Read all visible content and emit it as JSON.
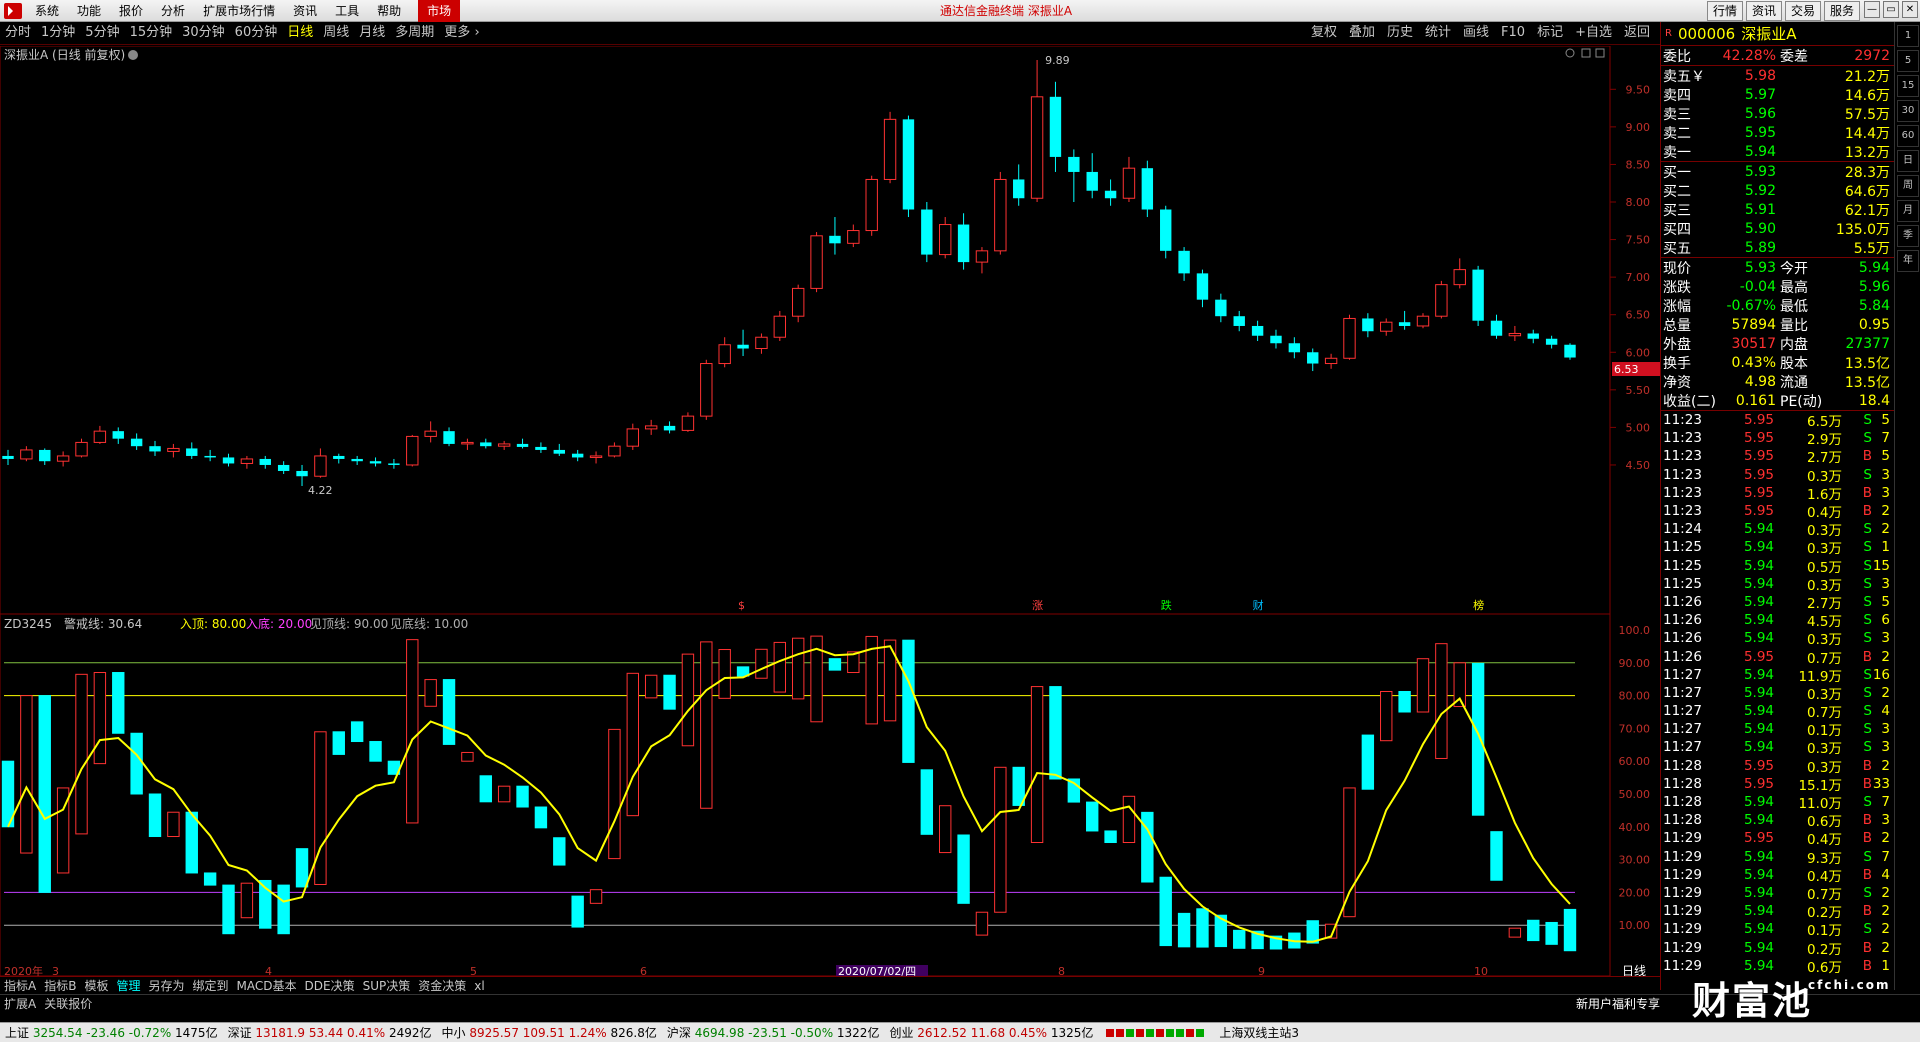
{
  "menubar": {
    "items": [
      "系统",
      "功能",
      "报价",
      "分析",
      "扩展市场行情",
      "资讯",
      "工具",
      "帮助"
    ],
    "market": "市场",
    "title": "通达信金融终端  深振业A",
    "right_buttons": [
      "行情",
      "资讯",
      "交易",
      "服务"
    ]
  },
  "periods": [
    "分时",
    "1分钟",
    "5分钟",
    "15分钟",
    "30分钟",
    "60分钟",
    "日线",
    "周线",
    "月线",
    "多周期",
    "更多"
  ],
  "active_period": "日线",
  "chart_tools": [
    "复权",
    "叠加",
    "历史",
    "统计",
    "画线",
    "F10",
    "标记",
    "+自选",
    "返回"
  ],
  "chart": {
    "title": "深振业A (日线 前复权)",
    "high_label": "9.89",
    "low_label": "4.22",
    "current_price_tag": "6.53",
    "y_ticks": [
      "9.50",
      "9.00",
      "8.50",
      "8.00",
      "7.50",
      "7.00",
      "6.50",
      "6.00",
      "5.50",
      "5.00",
      "4.50"
    ],
    "event_markers": [
      "$",
      "涨",
      "跌",
      "财",
      "榜"
    ],
    "date_axis": [
      "2020年",
      "3",
      "4",
      "5",
      "6",
      "2020/07/02/四",
      "8",
      "9",
      "10"
    ],
    "period_label": "日线"
  },
  "indicator": {
    "name": "ZD3245",
    "warn_label": "警戒线: 30.64",
    "params": [
      "入顶: 80.00",
      "入底: 20.00",
      "见顶线: 90.00",
      "见底线: 10.00"
    ],
    "y_ticks": [
      "100.0",
      "90.00",
      "80.00",
      "70.00",
      "60.00",
      "50.00",
      "40.00",
      "30.00",
      "20.00",
      "10.00"
    ]
  },
  "chart_data": {
    "type": "candlestick",
    "title": "深振业A (日线 前复权)",
    "ylim": [
      4.0,
      10.0
    ],
    "candles_ohlc": [
      [
        4.62,
        4.7,
        4.5,
        4.58
      ],
      [
        4.58,
        4.75,
        4.55,
        4.7
      ],
      [
        4.7,
        4.72,
        4.5,
        4.55
      ],
      [
        4.55,
        4.68,
        4.48,
        4.62
      ],
      [
        4.62,
        4.85,
        4.6,
        4.8
      ],
      [
        4.8,
        5.02,
        4.78,
        4.95
      ],
      [
        4.95,
        5.0,
        4.78,
        4.85
      ],
      [
        4.85,
        4.92,
        4.7,
        4.75
      ],
      [
        4.75,
        4.82,
        4.62,
        4.68
      ],
      [
        4.68,
        4.78,
        4.6,
        4.72
      ],
      [
        4.72,
        4.8,
        4.58,
        4.62
      ],
      [
        4.62,
        4.7,
        4.55,
        4.6
      ],
      [
        4.6,
        4.65,
        4.48,
        4.52
      ],
      [
        4.52,
        4.62,
        4.45,
        4.58
      ],
      [
        4.58,
        4.62,
        4.45,
        4.5
      ],
      [
        4.5,
        4.55,
        4.38,
        4.42
      ],
      [
        4.42,
        4.5,
        4.22,
        4.35
      ],
      [
        4.35,
        4.72,
        4.33,
        4.62
      ],
      [
        4.62,
        4.65,
        4.52,
        4.58
      ],
      [
        4.58,
        4.62,
        4.5,
        4.55
      ],
      [
        4.55,
        4.6,
        4.48,
        4.52
      ],
      [
        4.52,
        4.58,
        4.45,
        4.5
      ],
      [
        4.5,
        4.9,
        4.48,
        4.88
      ],
      [
        4.88,
        5.08,
        4.8,
        4.95
      ],
      [
        4.95,
        5.0,
        4.75,
        4.78
      ],
      [
        4.78,
        4.85,
        4.7,
        4.8
      ],
      [
        4.8,
        4.85,
        4.72,
        4.75
      ],
      [
        4.75,
        4.82,
        4.7,
        4.78
      ],
      [
        4.78,
        4.85,
        4.72,
        4.74
      ],
      [
        4.74,
        4.8,
        4.66,
        4.7
      ],
      [
        4.7,
        4.78,
        4.62,
        4.65
      ],
      [
        4.65,
        4.7,
        4.55,
        4.6
      ],
      [
        4.6,
        4.68,
        4.52,
        4.62
      ],
      [
        4.62,
        4.8,
        4.6,
        4.75
      ],
      [
        4.75,
        5.05,
        4.7,
        4.98
      ],
      [
        4.98,
        5.1,
        4.9,
        5.02
      ],
      [
        5.02,
        5.08,
        4.92,
        4.96
      ],
      [
        4.96,
        5.2,
        4.94,
        5.15
      ],
      [
        5.15,
        5.9,
        5.1,
        5.85
      ],
      [
        5.85,
        6.2,
        5.8,
        6.1
      ],
      [
        6.1,
        6.3,
        5.95,
        6.05
      ],
      [
        6.05,
        6.25,
        5.98,
        6.2
      ],
      [
        6.2,
        6.55,
        6.15,
        6.48
      ],
      [
        6.48,
        6.9,
        6.4,
        6.85
      ],
      [
        6.85,
        7.6,
        6.8,
        7.55
      ],
      [
        7.55,
        7.8,
        7.3,
        7.45
      ],
      [
        7.45,
        7.7,
        7.4,
        7.62
      ],
      [
        7.62,
        8.35,
        7.55,
        8.3
      ],
      [
        8.3,
        9.2,
        8.25,
        9.1
      ],
      [
        9.1,
        9.15,
        7.8,
        7.9
      ],
      [
        7.9,
        8.0,
        7.2,
        7.3
      ],
      [
        7.3,
        7.8,
        7.25,
        7.7
      ],
      [
        7.7,
        7.85,
        7.1,
        7.2
      ],
      [
        7.2,
        7.4,
        7.05,
        7.35
      ],
      [
        7.35,
        8.4,
        7.3,
        8.3
      ],
      [
        8.3,
        8.5,
        7.95,
        8.05
      ],
      [
        8.05,
        9.89,
        8.0,
        9.4
      ],
      [
        9.4,
        9.6,
        8.4,
        8.6
      ],
      [
        8.6,
        8.7,
        8.0,
        8.4
      ],
      [
        8.4,
        8.65,
        8.05,
        8.15
      ],
      [
        8.15,
        8.3,
        7.95,
        8.05
      ],
      [
        8.05,
        8.6,
        8.0,
        8.45
      ],
      [
        8.45,
        8.55,
        7.8,
        7.9
      ],
      [
        7.9,
        7.95,
        7.25,
        7.35
      ],
      [
        7.35,
        7.4,
        6.95,
        7.05
      ],
      [
        7.05,
        7.1,
        6.6,
        6.7
      ],
      [
        6.7,
        6.78,
        6.4,
        6.48
      ],
      [
        6.48,
        6.55,
        6.28,
        6.35
      ],
      [
        6.35,
        6.42,
        6.15,
        6.22
      ],
      [
        6.22,
        6.3,
        6.05,
        6.12
      ],
      [
        6.12,
        6.2,
        5.92,
        6.0
      ],
      [
        6.0,
        6.05,
        5.75,
        5.85
      ],
      [
        5.85,
        5.98,
        5.78,
        5.92
      ],
      [
        5.92,
        6.5,
        5.9,
        6.45
      ],
      [
        6.45,
        6.52,
        6.2,
        6.28
      ],
      [
        6.28,
        6.45,
        6.22,
        6.4
      ],
      [
        6.4,
        6.55,
        6.3,
        6.35
      ],
      [
        6.35,
        6.52,
        6.32,
        6.48
      ],
      [
        6.48,
        6.95,
        6.45,
        6.9
      ],
      [
        6.9,
        7.25,
        6.85,
        7.1
      ],
      [
        7.1,
        7.15,
        6.35,
        6.42
      ],
      [
        6.42,
        6.5,
        6.18,
        6.22
      ],
      [
        6.22,
        6.35,
        6.15,
        6.25
      ],
      [
        6.25,
        6.3,
        6.12,
        6.18
      ],
      [
        6.18,
        6.22,
        6.05,
        6.1
      ],
      [
        6.1,
        6.12,
        5.9,
        5.93
      ]
    ]
  },
  "quote": {
    "code": "000006",
    "name": "深振业A",
    "weibi_label": "委比",
    "weibi": "42.28%",
    "weicha_label": "委差",
    "weicha": "2972",
    "asks": [
      {
        "label": "卖五￥",
        "price": "5.98",
        "vol": "21.2万"
      },
      {
        "label": "卖四",
        "price": "5.97",
        "vol": "14.6万"
      },
      {
        "label": "卖三",
        "price": "5.96",
        "vol": "57.5万"
      },
      {
        "label": "卖二",
        "price": "5.95",
        "vol": "14.4万"
      },
      {
        "label": "卖一",
        "price": "5.94",
        "vol": "13.2万"
      }
    ],
    "bids": [
      {
        "label": "买一",
        "price": "5.93",
        "vol": "28.3万"
      },
      {
        "label": "买二",
        "price": "5.92",
        "vol": "64.6万"
      },
      {
        "label": "买三",
        "price": "5.91",
        "vol": "62.1万"
      },
      {
        "label": "买四",
        "price": "5.90",
        "vol": "135.0万"
      },
      {
        "label": "买五",
        "price": "5.89",
        "vol": "5.5万"
      }
    ],
    "stats": [
      {
        "l1": "现价",
        "v1": "5.93",
        "l2": "今开",
        "v2": "5.94",
        "c1": "green",
        "c2": "green"
      },
      {
        "l1": "涨跌",
        "v1": "-0.04",
        "l2": "最高",
        "v2": "5.96",
        "c1": "green",
        "c2": "green"
      },
      {
        "l1": "涨幅",
        "v1": "-0.67%",
        "l2": "最低",
        "v2": "5.84",
        "c1": "green",
        "c2": "green"
      },
      {
        "l1": "总量",
        "v1": "57894",
        "l2": "量比",
        "v2": "0.95",
        "c1": "yellow",
        "c2": "yellow"
      },
      {
        "l1": "外盘",
        "v1": "30517",
        "l2": "内盘",
        "v2": "27377",
        "c1": "red",
        "c2": "green"
      },
      {
        "l1": "换手",
        "v1": "0.43%",
        "l2": "股本",
        "v2": "13.5亿",
        "c1": "yellow",
        "c2": "yellow"
      },
      {
        "l1": "净资",
        "v1": "4.98",
        "l2": "流通",
        "v2": "13.5亿",
        "c1": "yellow",
        "c2": "yellow"
      },
      {
        "l1": "收益(二)",
        "v1": "0.161",
        "l2": "PE(动)",
        "v2": "18.4",
        "c1": "yellow",
        "c2": "yellow"
      }
    ],
    "ticks": [
      {
        "t": "11:23",
        "p": "5.95",
        "v": "6.5万",
        "s": "S",
        "n": "5"
      },
      {
        "t": "11:23",
        "p": "5.95",
        "v": "2.9万",
        "s": "S",
        "n": "7"
      },
      {
        "t": "11:23",
        "p": "5.95",
        "v": "2.7万",
        "s": "B",
        "n": "5"
      },
      {
        "t": "11:23",
        "p": "5.95",
        "v": "0.3万",
        "s": "S",
        "n": "3"
      },
      {
        "t": "11:23",
        "p": "5.95",
        "v": "1.6万",
        "s": "B",
        "n": "3"
      },
      {
        "t": "11:23",
        "p": "5.95",
        "v": "0.4万",
        "s": "B",
        "n": "2"
      },
      {
        "t": "11:24",
        "p": "5.94",
        "v": "0.3万",
        "s": "S",
        "n": "2"
      },
      {
        "t": "11:25",
        "p": "5.94",
        "v": "0.3万",
        "s": "S",
        "n": "1"
      },
      {
        "t": "11:25",
        "p": "5.94",
        "v": "0.5万",
        "s": "S",
        "n": "15"
      },
      {
        "t": "11:25",
        "p": "5.94",
        "v": "0.3万",
        "s": "S",
        "n": "3"
      },
      {
        "t": "11:26",
        "p": "5.94",
        "v": "2.7万",
        "s": "S",
        "n": "5"
      },
      {
        "t": "11:26",
        "p": "5.94",
        "v": "4.5万",
        "s": "S",
        "n": "6"
      },
      {
        "t": "11:26",
        "p": "5.94",
        "v": "0.3万",
        "s": "S",
        "n": "3"
      },
      {
        "t": "11:26",
        "p": "5.95",
        "v": "0.7万",
        "s": "B",
        "n": "2"
      },
      {
        "t": "11:27",
        "p": "5.94",
        "v": "11.9万",
        "s": "S",
        "n": "16"
      },
      {
        "t": "11:27",
        "p": "5.94",
        "v": "0.3万",
        "s": "S",
        "n": "2"
      },
      {
        "t": "11:27",
        "p": "5.94",
        "v": "0.7万",
        "s": "S",
        "n": "4"
      },
      {
        "t": "11:27",
        "p": "5.94",
        "v": "0.1万",
        "s": "S",
        "n": "3"
      },
      {
        "t": "11:27",
        "p": "5.94",
        "v": "0.3万",
        "s": "S",
        "n": "3"
      },
      {
        "t": "11:28",
        "p": "5.95",
        "v": "0.3万",
        "s": "B",
        "n": "2"
      },
      {
        "t": "11:28",
        "p": "5.95",
        "v": "15.1万",
        "s": "B",
        "n": "33"
      },
      {
        "t": "11:28",
        "p": "5.94",
        "v": "11.0万",
        "s": "S",
        "n": "7"
      },
      {
        "t": "11:28",
        "p": "5.94",
        "v": "0.6万",
        "s": "B",
        "n": "3"
      },
      {
        "t": "11:29",
        "p": "5.95",
        "v": "0.4万",
        "s": "B",
        "n": "2"
      },
      {
        "t": "11:29",
        "p": "5.94",
        "v": "9.3万",
        "s": "S",
        "n": "7"
      },
      {
        "t": "11:29",
        "p": "5.94",
        "v": "0.4万",
        "s": "B",
        "n": "4"
      },
      {
        "t": "11:29",
        "p": "5.94",
        "v": "0.7万",
        "s": "S",
        "n": "2"
      },
      {
        "t": "11:29",
        "p": "5.94",
        "v": "0.2万",
        "s": "B",
        "n": "2"
      },
      {
        "t": "11:29",
        "p": "5.94",
        "v": "0.1万",
        "s": "S",
        "n": "2"
      },
      {
        "t": "11:29",
        "p": "5.94",
        "v": "0.2万",
        "s": "B",
        "n": "2"
      },
      {
        "t": "11:29",
        "p": "5.94",
        "v": "0.6万",
        "s": "B",
        "n": "1"
      }
    ]
  },
  "sidebar": [
    "1",
    "5",
    "15",
    "30",
    "60",
    "日",
    "周",
    "月",
    "季",
    "年"
  ],
  "indicator_tabs": [
    "指标A",
    "指标B",
    "模板",
    "管理",
    "另存为",
    "绑定到",
    "MACD基本",
    "DDE决策",
    "SUP决策",
    "资金决策",
    "xl"
  ],
  "bottom_tabs": [
    "扩展A",
    "关联报价"
  ],
  "promo": "新用户福利专享",
  "status": [
    {
      "name": "上证",
      "price": "3254.54",
      "chg": "-23.46",
      "pct": "-0.72%",
      "amt": "1475亿",
      "dir": "down"
    },
    {
      "name": "深证",
      "price": "13181.9",
      "chg": "53.44",
      "pct": "0.41%",
      "amt": "2492亿",
      "dir": "up"
    },
    {
      "name": "中小",
      "price": "8925.57",
      "chg": "109.51",
      "pct": "1.24%",
      "amt": "826.8亿",
      "dir": "up"
    },
    {
      "name": "沪深",
      "price": "4694.98",
      "chg": "-23.51",
      "pct": "-0.50%",
      "amt": "1322亿",
      "dir": "down"
    },
    {
      "name": "创业",
      "price": "2612.52",
      "chg": "11.68",
      "pct": "0.45%",
      "amt": "1325亿",
      "dir": "up"
    }
  ],
  "status_server": "上海双线主站3",
  "watermark": "财富池",
  "watermark_sub": "cfchi.com"
}
